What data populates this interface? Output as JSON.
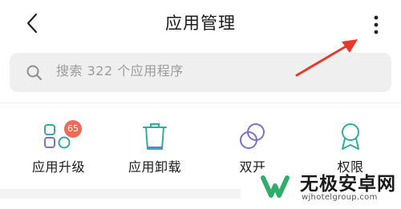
{
  "header": {
    "title": "应用管理",
    "back_icon": "chevron-left-icon",
    "more_icon": "more-vertical-icon"
  },
  "search": {
    "placeholder": "搜索 322 个应用程序",
    "icon": "search-icon"
  },
  "tools": [
    {
      "label": "应用升级",
      "icon": "grid-apps-icon",
      "badge": "65"
    },
    {
      "label": "应用卸载",
      "icon": "trash-icon"
    },
    {
      "label": "双开",
      "icon": "dual-circles-icon"
    },
    {
      "label": "权限",
      "icon": "award-badge-icon"
    }
  ],
  "watermark": {
    "name": "无极安卓网",
    "url": "wjhotelgroup.com"
  },
  "colors": {
    "accent_teal": "#2fae9b",
    "accent_purple": "#7d6fd0",
    "badge_red": "#f06a5a",
    "annotation_red": "#e8392e",
    "search_bg": "#efefef"
  }
}
